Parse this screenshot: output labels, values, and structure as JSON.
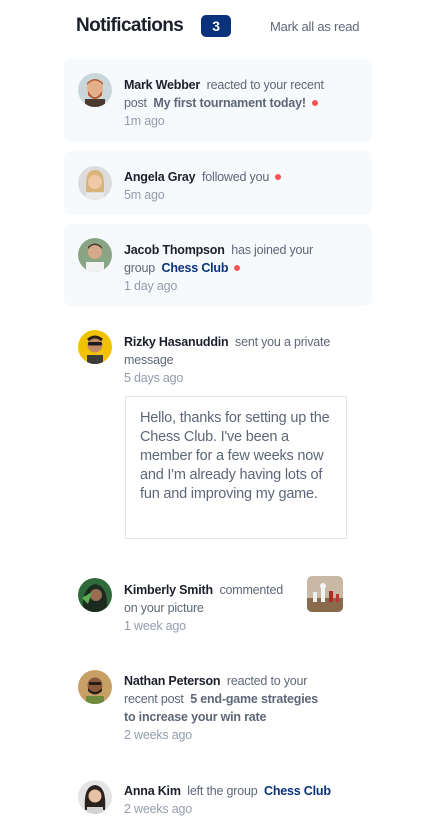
{
  "header": {
    "title": "Notifications",
    "count": "3",
    "mark_all": "Mark all as read"
  },
  "colors": {
    "unread_bg": "#f7fafd",
    "badge": "#0a317b",
    "dot": "#f65552",
    "group_link": "#0a327b"
  },
  "notifications": [
    {
      "name": "Mark Webber",
      "action": "reacted to your recent",
      "action2": "post",
      "target": "My first tournament today!",
      "time": "1m ago",
      "unread": true,
      "avatar": "mark-webber-avatar"
    },
    {
      "name": "Angela Gray",
      "action": "followed you",
      "time": "5m ago",
      "unread": true,
      "avatar": "angela-gray-avatar"
    },
    {
      "name": "Jacob Thompson",
      "action": "has joined your",
      "action2": "group",
      "target": "Chess Club",
      "time": "1 day ago",
      "unread": true,
      "avatar": "jacob-thompson-avatar"
    },
    {
      "name": "Rizky Hasanuddin",
      "action": "sent you a private",
      "action2": "message",
      "time": "5 days ago",
      "unread": false,
      "avatar": "rizky-hasanuddin-avatar",
      "message": "Hello, thanks for setting up the Chess Club. I've been a member for a few weeks now and I'm already having lots of fun and improving my game."
    },
    {
      "name": "Kimberly Smith",
      "action": "commented",
      "action2": "on your picture",
      "time": "1 week ago",
      "unread": false,
      "avatar": "kimberly-smith-avatar",
      "picture": "chess-picture-thumbnail"
    },
    {
      "name": "Nathan Peterson",
      "action": "reacted to your",
      "action2": "recent post",
      "target": "5 end-game strategies",
      "target2": "to increase your win rate",
      "time": "2 weeks ago",
      "unread": false,
      "avatar": "nathan-peterson-avatar"
    },
    {
      "name": "Anna Kim",
      "action": "left the group",
      "target": "Chess Club",
      "time": "2 weeks ago",
      "unread": false,
      "avatar": "anna-kim-avatar"
    }
  ]
}
